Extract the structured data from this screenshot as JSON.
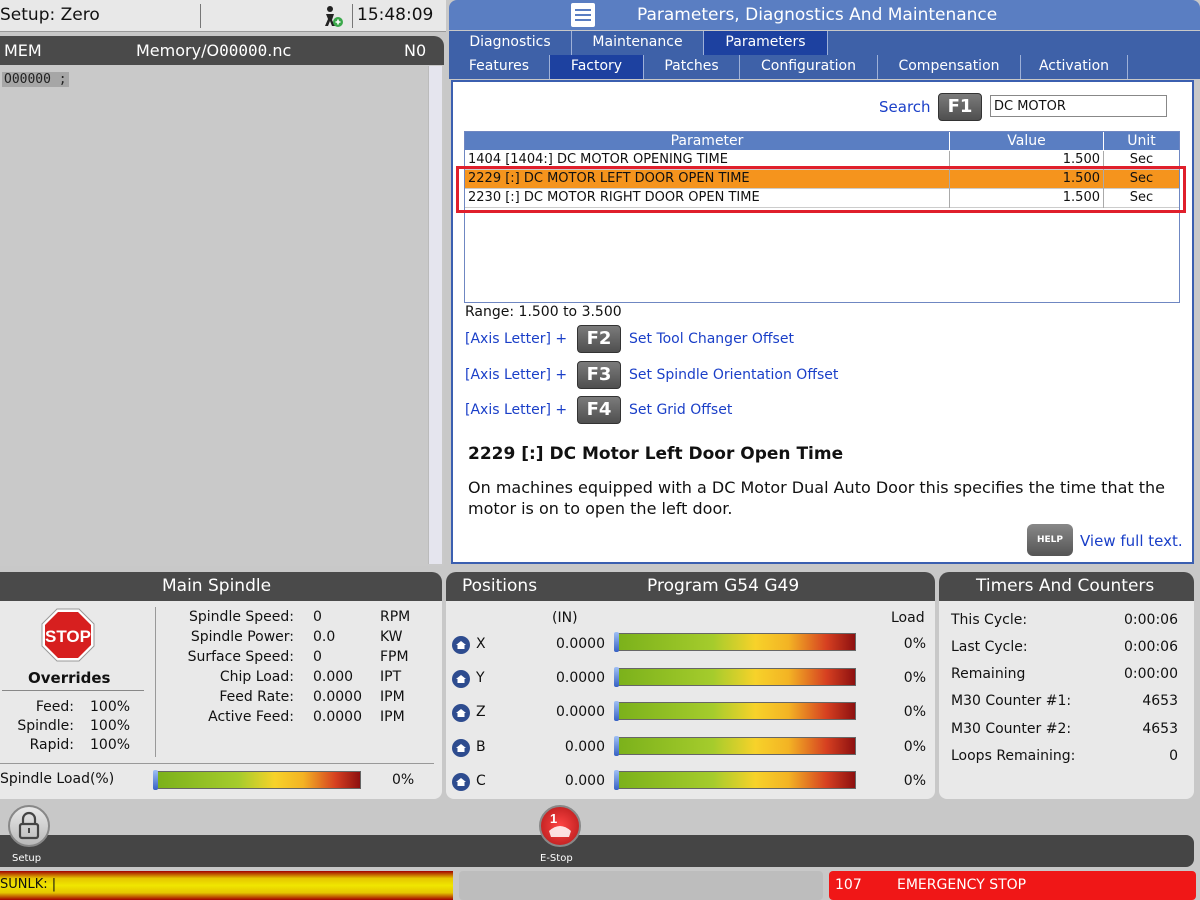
{
  "status_top": {
    "setup": "Setup: Zero",
    "time": "15:48:09"
  },
  "program": {
    "mode": "MEM",
    "file_prefix": "Memory/O",
    "file_num": "00000",
    "file_ext": ".nc",
    "n_value": "N0",
    "line": "O00000 ;"
  },
  "pdm": {
    "title": "Parameters, Diagnostics And Maintenance",
    "tabs_top": [
      "Diagnostics",
      "Maintenance",
      "Parameters"
    ],
    "tabs_bottom": [
      "Features",
      "Factory",
      "Patches",
      "Configuration",
      "Compensation",
      "Activation"
    ],
    "search_label": "Search",
    "search_key": "F1",
    "search_value": "DC MOTOR",
    "table_headers": [
      "Parameter",
      "Value",
      "Unit"
    ],
    "rows": [
      {
        "parameter": "1404 [1404:] DC MOTOR OPENING TIME",
        "value": "1.500",
        "unit": "Sec"
      },
      {
        "parameter": "2229 [:] DC MOTOR LEFT DOOR OPEN TIME",
        "value": "1.500",
        "unit": "Sec"
      },
      {
        "parameter": "2230 [:] DC MOTOR RIGHT DOOR OPEN TIME",
        "value": "1.500",
        "unit": "Sec"
      }
    ],
    "range": "Range: 1.500 to 3.500",
    "axis_label": "[Axis Letter] +",
    "fkeys": [
      {
        "key": "F2",
        "desc": "Set Tool Changer Offset"
      },
      {
        "key": "F3",
        "desc": "Set Spindle Orientation Offset"
      },
      {
        "key": "F4",
        "desc": "Set Grid Offset"
      }
    ],
    "desc_title": "2229 [:] DC Motor Left Door Open Time",
    "desc_text": "On machines equipped with a DC Motor Dual Auto Door this specifies the time that the motor is on to open the left door.",
    "help_label": "HELP",
    "view_full": "View full text."
  },
  "spindle": {
    "title": "Main Spindle",
    "stop": "STOP",
    "overrides": "Overrides",
    "override_items": [
      {
        "label": "Feed:",
        "value": "100%"
      },
      {
        "label": "Spindle:",
        "value": "100%"
      },
      {
        "label": "Rapid:",
        "value": "100%"
      }
    ],
    "stats": [
      {
        "label": "Spindle Speed:",
        "value": "0",
        "unit": "RPM"
      },
      {
        "label": "Spindle Power:",
        "value": "0.0",
        "unit": "KW"
      },
      {
        "label": "Surface Speed:",
        "value": "0",
        "unit": "FPM"
      },
      {
        "label": "Chip Load:",
        "value": "0.000",
        "unit": "IPT"
      },
      {
        "label": "Feed Rate:",
        "value": "0.0000",
        "unit": "IPM"
      },
      {
        "label": "Active Feed:",
        "value": "0.0000",
        "unit": "IPM"
      }
    ],
    "load_label": "Spindle Load(%)",
    "load_value": "0%"
  },
  "positions": {
    "title": "Positions",
    "program": "Program G54 G49",
    "unit": "(IN)",
    "load_header": "Load",
    "axes": [
      {
        "axis": "X",
        "value": "0.0000",
        "load": "0%"
      },
      {
        "axis": "Y",
        "value": "0.0000",
        "load": "0%"
      },
      {
        "axis": "Z",
        "value": "0.0000",
        "load": "0%"
      },
      {
        "axis": "B",
        "value": "0.000",
        "load": "0%"
      },
      {
        "axis": "C",
        "value": "0.000",
        "load": "0%"
      }
    ]
  },
  "timers": {
    "title": "Timers And Counters",
    "items": [
      {
        "label": "This Cycle:",
        "value": "0:00:06"
      },
      {
        "label": "Last Cycle:",
        "value": "0:00:06"
      },
      {
        "label": "Remaining",
        "value": "0:00:00"
      },
      {
        "label": "M30 Counter #1:",
        "value": "4653"
      },
      {
        "label": "M30 Counter #2:",
        "value": "4653"
      },
      {
        "label": "Loops Remaining:",
        "value": "0"
      }
    ]
  },
  "toolbar": {
    "setup": "Setup",
    "estop": "E-Stop",
    "estop_badge": "1"
  },
  "statusbar": {
    "unlock": "SUNLK: |",
    "alarm_code": "107",
    "alarm_text": "EMERGENCY STOP"
  },
  "colors": {
    "accent": "#5a7ec2",
    "selected_row": "#f5941d",
    "alarm": "#f01717",
    "link": "#1a3fc8"
  }
}
